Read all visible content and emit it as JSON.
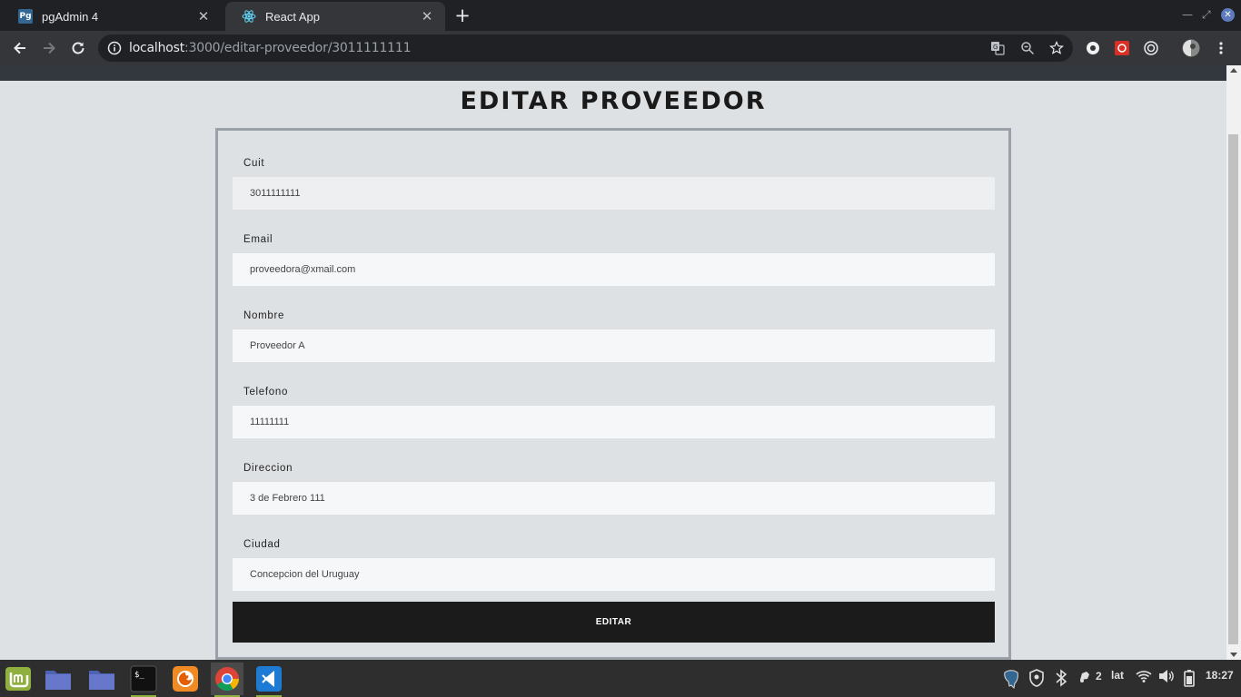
{
  "browser": {
    "tabs": [
      {
        "title": "pgAdmin 4",
        "favicon": "pgadmin-favicon",
        "favicon_text": "Pg"
      },
      {
        "title": "React App",
        "favicon": "react-favicon"
      }
    ],
    "tab_close_glyph": "✕",
    "new_tab_glyph": "+",
    "url_host": "localhost",
    "url_rest": ":3000/editar-proveedor/3011111111"
  },
  "page": {
    "title": "EDITAR PROVEEDOR",
    "fields": [
      {
        "label": "Cuit",
        "value": "3011111111",
        "readonly": true
      },
      {
        "label": "Email",
        "value": "proveedora@xmail.com"
      },
      {
        "label": "Nombre",
        "value": "Proveedor A"
      },
      {
        "label": "Telefono",
        "value": "11111111"
      },
      {
        "label": "Direccion",
        "value": "3 de Febrero 111"
      },
      {
        "label": "Ciudad",
        "value": "Concepcion del Uruguay"
      }
    ],
    "submit_label": "EDITAR"
  },
  "taskbar": {
    "apps": [
      "mint-menu",
      "files",
      "files-2",
      "terminal",
      "firefox",
      "chrome",
      "vscode"
    ],
    "workspace_count": "2",
    "keyboard_layout": "lat",
    "clock": "18:27"
  },
  "colors": {
    "page_bg": "#dee1e4",
    "submit_bg": "#1b1b1b",
    "card_border": "#9aa1a9"
  }
}
